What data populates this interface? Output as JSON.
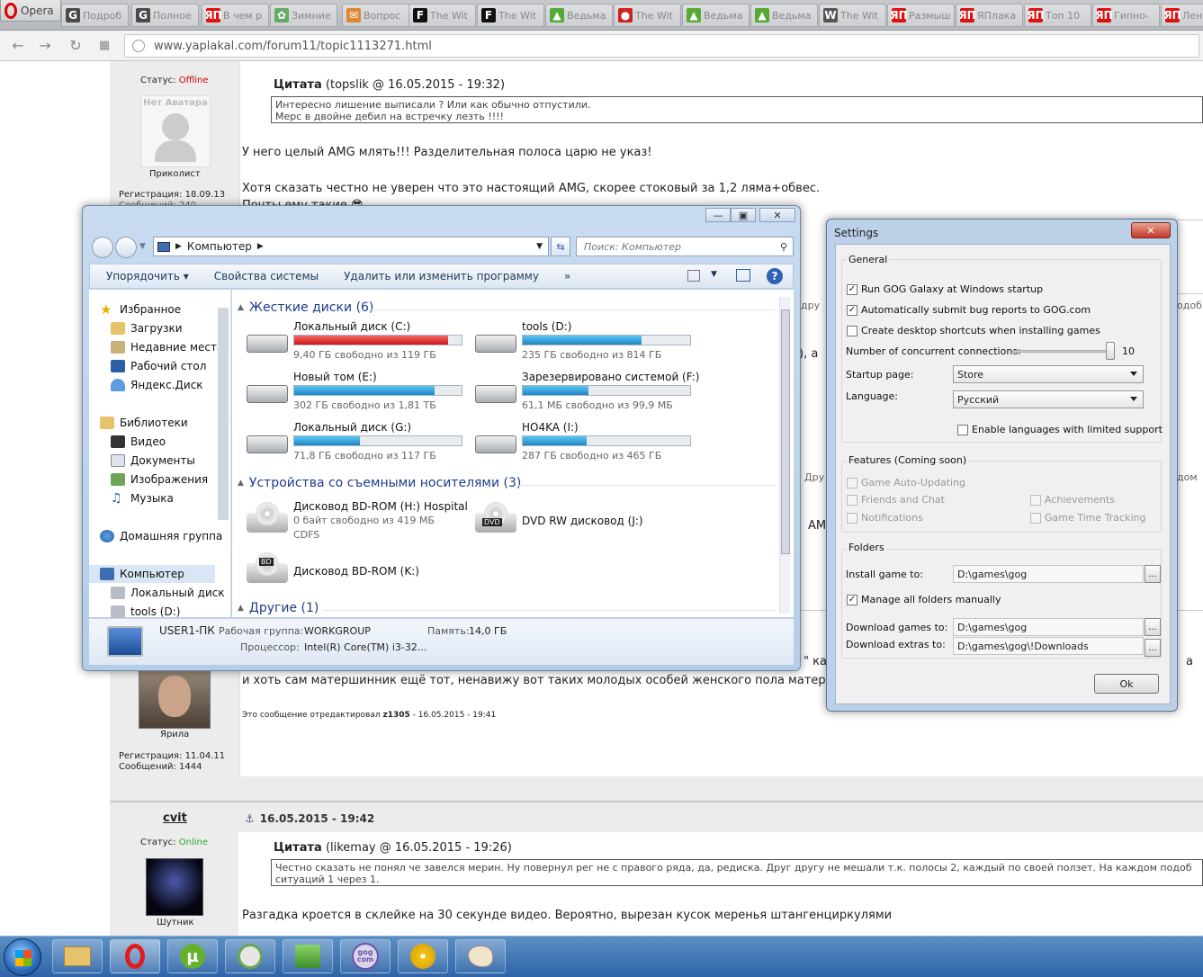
{
  "browser": {
    "opera_label": "Opera",
    "tabs": [
      {
        "label": "Подроб",
        "icon": "G",
        "color": "#4a4a4a"
      },
      {
        "label": "Полное",
        "icon": "G",
        "color": "#4a4a4a"
      },
      {
        "label": "В чем р",
        "icon": "ЯП",
        "color": "#d11"
      },
      {
        "label": "Зимние",
        "icon": "✿",
        "color": "#6a6"
      },
      {
        "label": "Вопрос",
        "icon": "✉",
        "color": "#d83"
      },
      {
        "label": "The Wit",
        "icon": "F",
        "color": "#111"
      },
      {
        "label": "The Wit",
        "icon": "F",
        "color": "#111"
      },
      {
        "label": "Ведьма",
        "icon": "▲",
        "color": "#5a3"
      },
      {
        "label": "The Wit",
        "icon": "●",
        "color": "#c22"
      },
      {
        "label": "Ведьма",
        "icon": "▲",
        "color": "#5a3"
      },
      {
        "label": "Ведьма",
        "icon": "▲",
        "color": "#5a3"
      },
      {
        "label": "The Wit",
        "icon": "W",
        "color": "#555"
      },
      {
        "label": "Размыш",
        "icon": "ЯП",
        "color": "#d11"
      },
      {
        "label": "ЯПлака",
        "icon": "ЯП",
        "color": "#d11"
      },
      {
        "label": "Топ 10",
        "icon": "ЯП",
        "color": "#d11"
      },
      {
        "label": "Гипно-",
        "icon": "ЯП",
        "color": "#d11"
      },
      {
        "label": "Лент",
        "icon": "ЯП",
        "color": "#d11"
      }
    ],
    "url": "www.yaplakal.com/forum11/topic1113271.html"
  },
  "forum": {
    "post1": {
      "status_label": "Статус:",
      "status_value": "Offline",
      "avatar_text": "Нет Аватара",
      "rank": "Приколист",
      "reg": "Регистрация: 18.09.13",
      "reg_overlap": "Сообщений: 240",
      "quote_header": "Цитата",
      "quote_meta": "(topslik @ 16.05.2015 - 19:32)",
      "quote_line1": "Интересно лишение выписали ? Или как обычно отпустили.",
      "quote_line2": "Мерс в двойне дебил на встречку лезть !!!!",
      "line1": "У него целый AMG млять!!! Разделительная полоса царю не указ!",
      "line2": "Хотя сказать честно не уверен что это настоящий AMG, скорее стоковый за 1,2 ляма+обвес.",
      "line3": "Почты ему такие 😎"
    },
    "frag": {
      "a": "), а",
      "b": "Дру",
      "c": "AMG",
      "d": "\" ка",
      "e": "а",
      "f": "дру",
      "g": "одоб",
      "h": "дом"
    },
    "post2": {
      "line": "и хоть сам матершинник ещё тот, ненавижу вот таких молодых особей женского пола матерящихся",
      "edit_prefix": "Это сообщение отредактировал",
      "edit_user": "z1305",
      "edit_date": "- 16.05.2015 - 19:41",
      "rank": "Ярила",
      "reg": "Регистрация: 11.04.11",
      "msgs": "Сообщений: 1444"
    },
    "post3": {
      "user": "cvit",
      "date": "16.05.2015 - 19:42",
      "status_label": "Статус:",
      "status_value": "Online",
      "rank": "Шутник",
      "quote_header": "Цитата",
      "quote_meta": "(likemay @ 16.05.2015 - 19:26)",
      "quote_line1": "Честно сказать не понял че завелся мерин. Ну повернул рег не с правого ряда, да, редиска. Друг другу не мешали т.к. полосы 2, каждый по своей ползет. На каждом подоб",
      "quote_line2": "ситуаций 1 через 1.",
      "line": "Разгадка кроется в склейке на 30 секунде видео. Вероятно, вырезан кусок меренья штангенциркулями"
    }
  },
  "explorer": {
    "address": "Компьютер",
    "search_placeholder": "Поиск: Компьютер",
    "toolbar": {
      "organize": "Упорядочить",
      "system_props": "Свойства системы",
      "uninstall": "Удалить или изменить программу",
      "more": "»"
    },
    "nav": {
      "favorites": "Избранное",
      "downloads": "Загрузки",
      "recent": "Недавние места",
      "desktop": "Рабочий стол",
      "yadisk": "Яндекс.Диск",
      "libraries": "Библиотеки",
      "video": "Видео",
      "docs": "Документы",
      "images": "Изображения",
      "music": "Музыка",
      "homegroup": "Домашняя группа",
      "computer": "Компьютер",
      "localc": "Локальный диск",
      "toolsd": "tools (D:)"
    },
    "groups": {
      "hdd": "Жесткие диски (6)",
      "removable": "Устройства со съемными носителями (3)",
      "other": "Другие (1)"
    },
    "drives": [
      {
        "name": "Локальный диск (C:)",
        "free": "9,40 ГБ свободно из 119 ГБ",
        "used": 0.92
      },
      {
        "name": "tools (D:)",
        "free": "235 ГБ свободно из 814 ГБ",
        "used": 0.71
      },
      {
        "name": "Новый том (E:)",
        "free": "302 ГБ свободно из 1,81 ТБ",
        "used": 0.84
      },
      {
        "name": "Зарезервировано системой (F:)",
        "free": "61,1 МБ свободно из 99,9 МБ",
        "used": 0.39
      },
      {
        "name": "Локальный диск (G:)",
        "free": "71,8 ГБ свободно из 117 ГБ",
        "used": 0.39
      },
      {
        "name": "HO4KA (I:)",
        "free": "287 ГБ свободно из 465 ГБ",
        "used": 0.38
      }
    ],
    "removable": [
      {
        "name": "Дисковод BD-ROM (H:) Hospital",
        "sub1": "0 байт свободно из 419 МБ",
        "sub2": "CDFS",
        "badge": ""
      },
      {
        "name": "DVD RW дисковод (J:)",
        "badge": "DVD"
      },
      {
        "name": "Дисковод BD-ROM (K:)",
        "badge": "BD"
      }
    ],
    "details": {
      "pc": "USER1-ПК",
      "wg_label": "Рабочая группа:",
      "wg": "WORKGROUP",
      "mem_label": "Память:",
      "mem": "14,0 ГБ",
      "cpu_label": "Процессор:",
      "cpu": "Intel(R) Core(TM) i3-32..."
    }
  },
  "settings": {
    "title": "Settings",
    "general": "General",
    "run_startup": "Run GOG Galaxy at Windows startup",
    "bug_reports": "Automatically submit bug reports to GOG.com",
    "shortcuts": "Create desktop shortcuts when installing games",
    "connections": "Number of concurrent connections:",
    "connections_value": "10",
    "connections_level": 1.0,
    "startup_page": "Startup page:",
    "startup_value": "Store",
    "language": "Language:",
    "language_value": "Русский",
    "limited_lang": "Enable languages with limited support",
    "features": "Features (Coming soon)",
    "auto_update": "Game Auto-Updating",
    "friends": "Friends and Chat",
    "achievements": "Achievements",
    "notifications": "Notifications",
    "time_tracking": "Game Time Tracking",
    "folders": "Folders",
    "install_to": "Install game to:",
    "install_value": "D:\\games\\gog",
    "manage": "Manage all folders manually",
    "download_games": "Download games to:",
    "download_games_value": "D:\\games\\gog",
    "download_extras": "Download extras to:",
    "download_extras_value": "D:\\games\\gog\\!Downloads",
    "browse": "...",
    "ok": "Ok"
  },
  "taskbar": {
    "gog": "gog com"
  }
}
